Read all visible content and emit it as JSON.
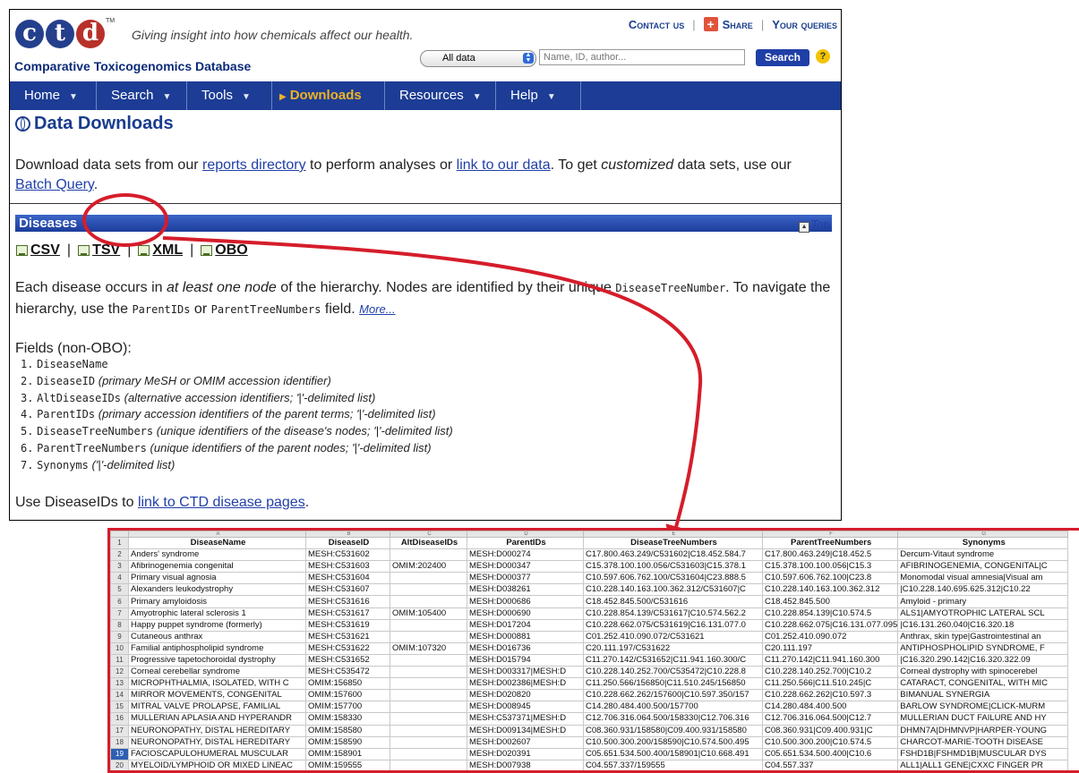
{
  "header": {
    "logo_letters": [
      "c",
      "t",
      "d"
    ],
    "logo_tm": "TM",
    "tagline": "Giving insight into how chemicals affect our health.",
    "site_name": "Comparative Toxicogenomics Database",
    "top_links": {
      "contact": "Contact us",
      "share": "Share",
      "queries": "Your queries"
    },
    "search": {
      "select_value": "All data",
      "placeholder": "Name, ID, author...",
      "button": "Search",
      "help": "?"
    }
  },
  "nav": [
    {
      "label": "Home",
      "active": false
    },
    {
      "label": "Search",
      "active": false
    },
    {
      "label": "Tools",
      "active": false
    },
    {
      "label": "Downloads",
      "active": true
    },
    {
      "label": "Resources",
      "active": false
    },
    {
      "label": "Help",
      "active": false
    }
  ],
  "page": {
    "title": "Data Downloads",
    "intro": {
      "p1": "Download data sets from our ",
      "link1": "reports directory",
      "p2": " to perform analyses or ",
      "link2": "link to our data",
      "p3": ". To get ",
      "em": "customized",
      "p4": " data sets, use our ",
      "link3": "Batch Query",
      "p5": "."
    },
    "section": {
      "title": "Diseases",
      "top": "Top",
      "formats": [
        "CSV",
        "TSV",
        "XML",
        "OBO"
      ],
      "desc": {
        "a": "Each disease occurs in ",
        "em": "at least one node",
        "b": " of the hierarchy. Nodes are identified by their unique ",
        "code1": "DiseaseTreeNumber",
        "c": ". To navigate the hierarchy, use the ",
        "code2": "ParentIDs",
        "d": " or ",
        "code3": "ParentTreeNumbers",
        "e": " field. ",
        "more": "More..."
      },
      "fields_heading": "Fields (non-OBO):",
      "fields": [
        {
          "num": "1.",
          "code": "DiseaseName",
          "desc": ""
        },
        {
          "num": "2.",
          "code": "DiseaseID",
          "desc": "(primary MeSH or OMIM accession identifier)"
        },
        {
          "num": "3.",
          "code": "AltDiseaseIDs",
          "desc": "(alternative accession identifiers; '|'-delimited list)"
        },
        {
          "num": "4.",
          "code": "ParentIDs",
          "desc": "(primary accession identifiers of the parent terms; '|'-delimited list)"
        },
        {
          "num": "5.",
          "code": "DiseaseTreeNumbers",
          "desc": "(unique identifiers of the disease's nodes; '|'-delimited list)"
        },
        {
          "num": "6.",
          "code": "ParentTreeNumbers",
          "desc": "(unique identifiers of the parent nodes; '|'-delimited list)"
        },
        {
          "num": "7.",
          "code": "Synonyms",
          "desc": "('|'-delimited list)"
        }
      ],
      "use": {
        "a": "Use DiseaseIDs to ",
        "link": "link to CTD disease pages",
        "b": "."
      }
    }
  },
  "spreadsheet": {
    "col_letters": [
      "A",
      "B",
      "C",
      "D",
      "E",
      "F",
      "G"
    ],
    "headers": [
      "DiseaseName",
      "DiseaseID",
      "AltDiseaseIDs",
      "ParentIDs",
      "DiseaseTreeNumbers",
      "ParentTreeNumbers",
      "Synonyms"
    ],
    "selected_row": "19",
    "rows": [
      [
        "Anders' syndrome",
        "MESH:C531602",
        "",
        "MESH:D000274",
        "C17.800.463.249/C531602|C18.452.584.7",
        "C17.800.463.249|C18.452.5",
        "Dercum-Vitaut syndrome"
      ],
      [
        "Afibrinogenemia congenital",
        "MESH:C531603",
        "OMIM:202400",
        "MESH:D000347",
        "C15.378.100.100.056/C531603|C15.378.1",
        "C15.378.100.100.056|C15.3",
        "AFIBRINOGENEMIA, CONGENITAL|C"
      ],
      [
        "Primary visual agnosia",
        "MESH:C531604",
        "",
        "MESH:D000377",
        "C10.597.606.762.100/C531604|C23.888.5",
        "C10.597.606.762.100|C23.8",
        "Monomodal visual amnesia|Visual am"
      ],
      [
        "Alexanders leukodystrophy",
        "MESH:C531607",
        "",
        "MESH:D038261",
        "C10.228.140.163.100.362.312/C531607|C",
        "C10.228.140.163.100.362.312",
        "|C10.228.140.695.625.312|C10.22"
      ],
      [
        "Primary amyloidosis",
        "MESH:C531616",
        "",
        "MESH:D000686",
        "C18.452.845.500/C531616",
        "C18.452.845.500",
        "Amyloid - primary"
      ],
      [
        "Amyotrophic lateral sclerosis 1",
        "MESH:C531617",
        "OMIM:105400",
        "MESH:D000690",
        "C10.228.854.139/C531617|C10.574.562.2",
        "C10.228.854.139|C10.574.5",
        "ALS1|AMYOTROPHIC LATERAL SCL"
      ],
      [
        "Happy puppet syndrome (formerly)",
        "MESH:C531619",
        "",
        "MESH:D017204",
        "C10.228.662.075/C531619|C16.131.077.0",
        "C10.228.662.075|C16.131.077.095",
        "|C16.131.260.040|C16.320.18"
      ],
      [
        "Cutaneous anthrax",
        "MESH:C531621",
        "",
        "MESH:D000881",
        "C01.252.410.090.072/C531621",
        "C01.252.410.090.072",
        "Anthrax, skin type|Gastrointestinal an"
      ],
      [
        "Familial antiphospholipid syndrome",
        "MESH:C531622",
        "OMIM:107320",
        "MESH:D016736",
        "C20.111.197/C531622",
        "C20.111.197",
        "ANTIPHOSPHOLIPID SYNDROME, F"
      ],
      [
        "Progressive tapetochoroidal dystrophy",
        "MESH:C531652",
        "",
        "MESH:D015794",
        "C11.270.142/C531652|C11.941.160.300/C",
        "C11.270.142|C11.941.160.300",
        "|C16.320.290.142|C16.320.322.09"
      ],
      [
        "Corneal cerebellar syndrome",
        "MESH:C535472",
        "",
        "MESH:D003317|MESH:D",
        "C10.228.140.252.700/C535472|C10.228.8",
        "C10.228.140.252.700|C10.2",
        "Corneal dystrophy with spinocerebel"
      ],
      [
        "MICROPHTHALMIA, ISOLATED, WITH C",
        "OMIM:156850",
        "",
        "MESH:D002386|MESH:D",
        "C11.250.566/156850|C11.510.245/156850",
        "C11.250.566|C11.510.245|C",
        "CATARACT, CONGENITAL, WITH MIC"
      ],
      [
        "MIRROR MOVEMENTS, CONGENITAL",
        "OMIM:157600",
        "",
        "MESH:D020820",
        "C10.228.662.262/157600|C10.597.350/157",
        "C10.228.662.262|C10.597.3",
        "BIMANUAL SYNERGIA"
      ],
      [
        "MITRAL VALVE PROLAPSE, FAMILIAL",
        "OMIM:157700",
        "",
        "MESH:D008945",
        "C14.280.484.400.500/157700",
        "C14.280.484.400.500",
        "BARLOW SYNDROME|CLICK-MURM"
      ],
      [
        "MULLERIAN APLASIA AND HYPERANDR",
        "OMIM:158330",
        "",
        "MESH:C537371|MESH:D",
        "C12.706.316.064.500/158330|C12.706.316",
        "C12.706.316.064.500|C12.7",
        "MULLERIAN DUCT FAILURE AND HY"
      ],
      [
        "NEURONOPATHY, DISTAL HEREDITARY",
        "OMIM:158580",
        "",
        "MESH:D009134|MESH:D",
        "C08.360.931/158580|C09.400.931/158580",
        "C08.360.931|C09.400.931|C",
        "DHMN7A|DHMNVP|HARPER-YOUNG"
      ],
      [
        "NEURONOPATHY, DISTAL HEREDITARY",
        "OMIM:158590",
        "",
        "MESH:D002607",
        "C10.500.300.200/158590|C10.574.500.495",
        "C10.500.300.200|C10.574.5",
        "CHARCOT-MARIE-TOOTH DISEASE"
      ],
      [
        "FACIOSCAPULOHUMERAL MUSCULAR",
        "OMIM:158901",
        "",
        "MESH:D020391",
        "C05.651.534.500.400/158901|C10.668.491",
        "C05.651.534.500.400|C10.6",
        "FSHD1B|FSHMD1B|MUSCULAR DYS"
      ],
      [
        "MYELOID/LYMPHOID OR MIXED LINEAC",
        "OMIM:159555",
        "",
        "MESH:D007938",
        "C04.557.337/159555",
        "C04.557.337",
        "ALL1|ALL1 GENE|CXXC FINGER PR"
      ]
    ]
  },
  "colors": {
    "nav_bg": "#1c3c95",
    "accent": "#f0b323",
    "annotation": "#d51d2b",
    "link": "#2140a8"
  }
}
